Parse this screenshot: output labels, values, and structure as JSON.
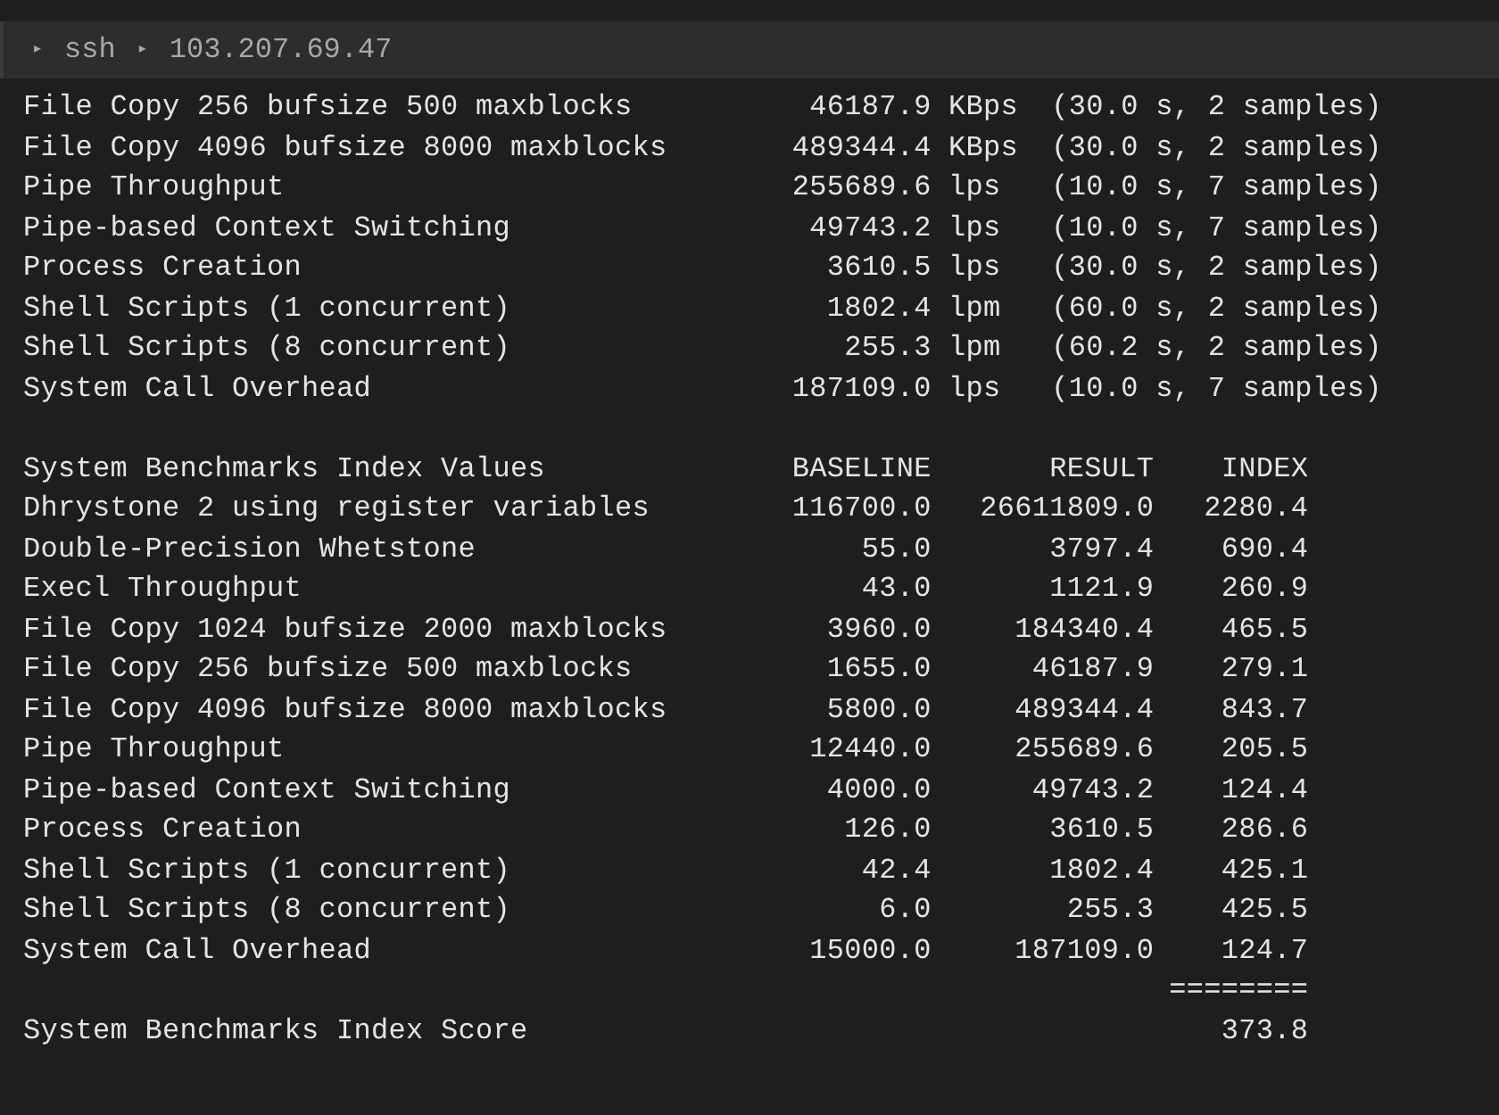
{
  "breadcrumb": [
    {
      "separator": "▸",
      "label": "ssh"
    },
    {
      "separator": "▸",
      "label": "103.207.69.47"
    }
  ],
  "results": [
    {
      "name": "File Copy 256 bufsize 500 maxblocks",
      "value": "46187.9",
      "unit": "KBps",
      "detail": "(30.0 s, 2 samples)"
    },
    {
      "name": "File Copy 4096 bufsize 8000 maxblocks",
      "value": "489344.4",
      "unit": "KBps",
      "detail": "(30.0 s, 2 samples)"
    },
    {
      "name": "Pipe Throughput",
      "value": "255689.6",
      "unit": "lps",
      "detail": "(10.0 s, 7 samples)"
    },
    {
      "name": "Pipe-based Context Switching",
      "value": "49743.2",
      "unit": "lps",
      "detail": "(10.0 s, 7 samples)"
    },
    {
      "name": "Process Creation",
      "value": "3610.5",
      "unit": "lps",
      "detail": "(30.0 s, 2 samples)"
    },
    {
      "name": "Shell Scripts (1 concurrent)",
      "value": "1802.4",
      "unit": "lpm",
      "detail": "(60.0 s, 2 samples)"
    },
    {
      "name": "Shell Scripts (8 concurrent)",
      "value": "255.3",
      "unit": "lpm",
      "detail": "(60.2 s, 2 samples)"
    },
    {
      "name": "System Call Overhead",
      "value": "187109.0",
      "unit": "lps",
      "detail": "(10.0 s, 7 samples)"
    }
  ],
  "index_table": {
    "columns": [
      "System Benchmarks Index Values",
      "BASELINE",
      "RESULT",
      "INDEX"
    ],
    "rows": [
      [
        "Dhrystone 2 using register variables",
        "116700.0",
        "26611809.0",
        "2280.4"
      ],
      [
        "Double-Precision Whetstone",
        "55.0",
        "3797.4",
        "690.4"
      ],
      [
        "Execl Throughput",
        "43.0",
        "1121.9",
        "260.9"
      ],
      [
        "File Copy 1024 bufsize 2000 maxblocks",
        "3960.0",
        "184340.4",
        "465.5"
      ],
      [
        "File Copy 256 bufsize 500 maxblocks",
        "1655.0",
        "46187.9",
        "279.1"
      ],
      [
        "File Copy 4096 bufsize 8000 maxblocks",
        "5800.0",
        "489344.4",
        "843.7"
      ],
      [
        "Pipe Throughput",
        "12440.0",
        "255689.6",
        "205.5"
      ],
      [
        "Pipe-based Context Switching",
        "4000.0",
        "49743.2",
        "124.4"
      ],
      [
        "Process Creation",
        "126.0",
        "3610.5",
        "286.6"
      ],
      [
        "Shell Scripts (1 concurrent)",
        "42.4",
        "1802.4",
        "425.1"
      ],
      [
        "Shell Scripts (8 concurrent)",
        "6.0",
        "255.3",
        "425.5"
      ],
      [
        "System Call Overhead",
        "15000.0",
        "187109.0",
        "124.7"
      ]
    ],
    "separator": "========",
    "score": {
      "label": "System Benchmarks Index Score",
      "value": "373.8"
    }
  }
}
